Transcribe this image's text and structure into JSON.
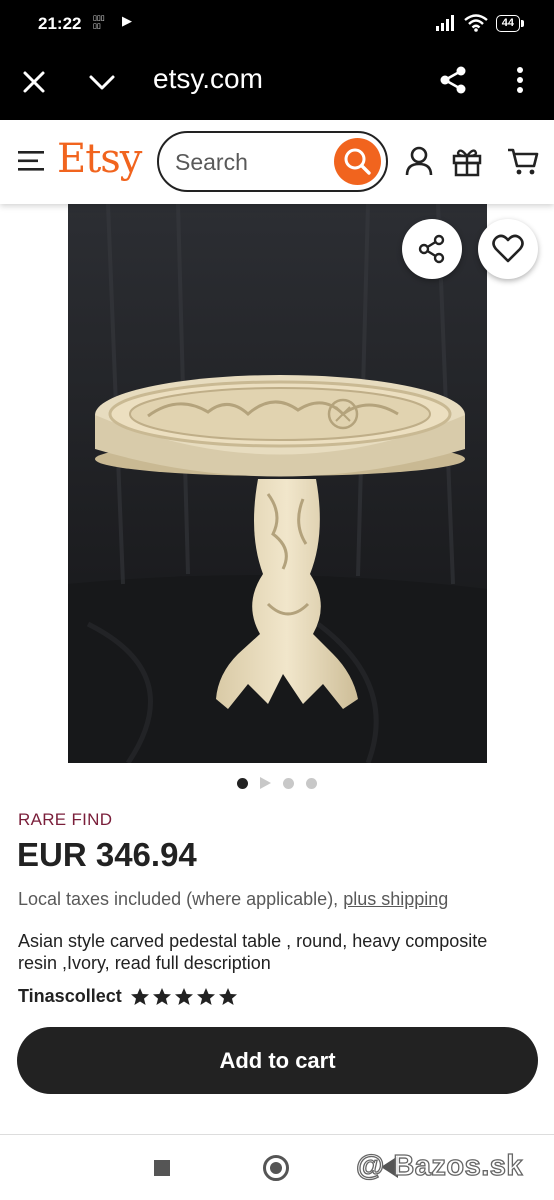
{
  "status_bar": {
    "time": "21:22",
    "notif_app_label": "TEMU",
    "battery": "44"
  },
  "browser": {
    "url": "etsy.com"
  },
  "header": {
    "logo": "Etsy",
    "search_placeholder": "Search",
    "brand_color": "#f1641e"
  },
  "gallery": {
    "image_alt": "Carved round pedestal table",
    "dots": 4,
    "active_dot": 1
  },
  "listing": {
    "badge": "RARE FIND",
    "price": "EUR 346.94",
    "taxes_text": "Local taxes included (where applicable),",
    "shipping_link": "plus shipping",
    "title": "Asian style carved pedestal table , round, heavy composite resin ,Ivory, read full description",
    "shop_name": "Tinascollect",
    "rating_stars": 5,
    "add_to_cart": "Add to cart"
  },
  "watermark": "@ Bazos.sk"
}
